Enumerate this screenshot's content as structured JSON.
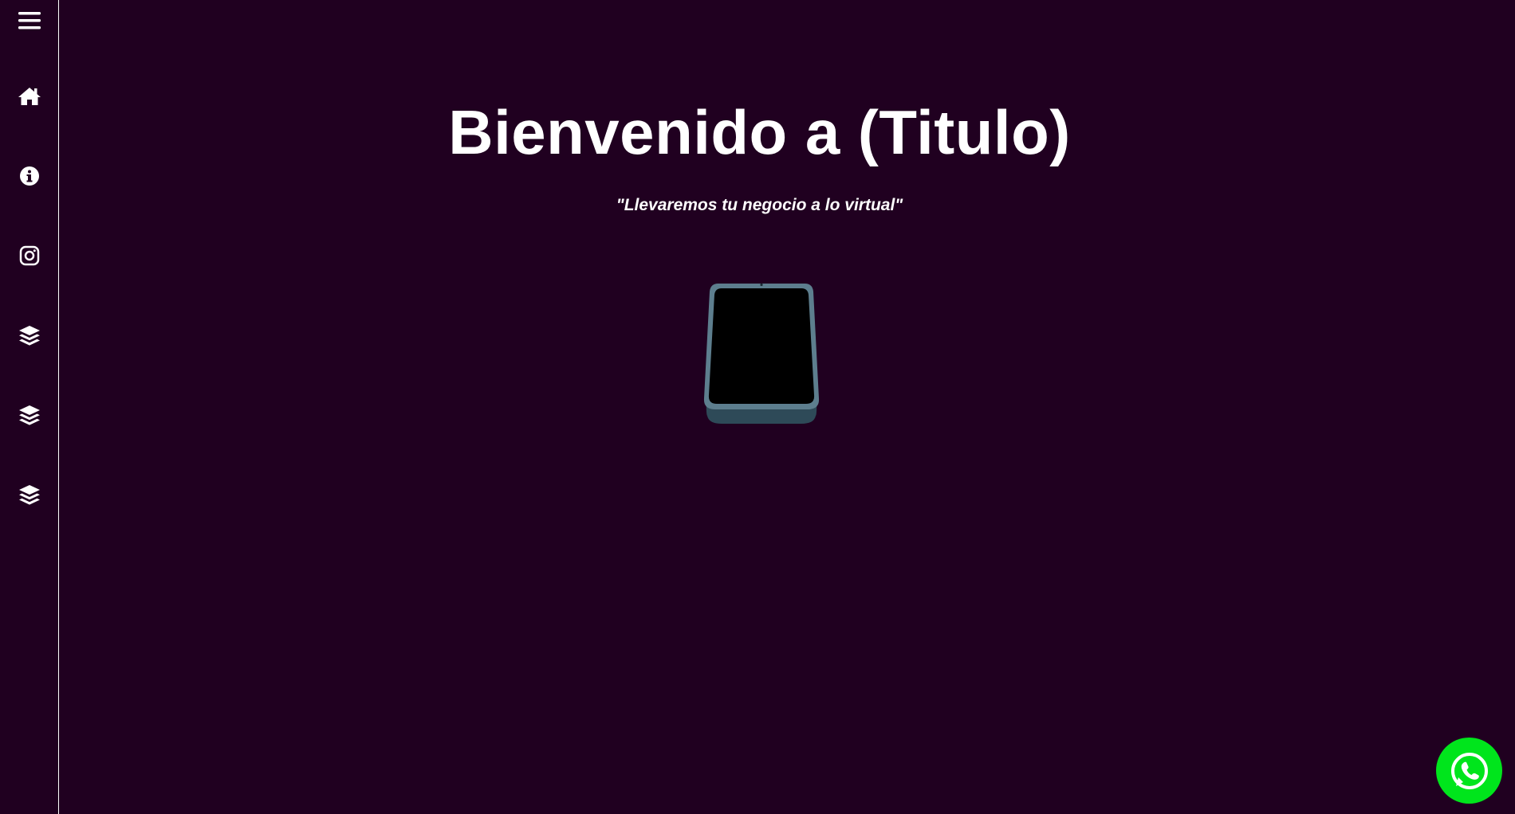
{
  "sidebar": {
    "items": [
      {
        "icon": "menu-icon"
      },
      {
        "icon": "home-icon"
      },
      {
        "icon": "info-icon"
      },
      {
        "icon": "instagram-icon"
      },
      {
        "icon": "layers-icon"
      },
      {
        "icon": "layers-icon"
      },
      {
        "icon": "layers-icon"
      }
    ]
  },
  "hero": {
    "title": "Bienvenido a (Titulo)",
    "subtitle": "\"Llevaremos tu negocio a lo virtual\""
  },
  "floating_button": {
    "icon": "whatsapp-icon",
    "color": "#00e51c"
  },
  "colors": {
    "background": "#200020",
    "text": "#ffffff",
    "phone_frame": "#5a7a8a",
    "phone_screen": "#000000"
  }
}
